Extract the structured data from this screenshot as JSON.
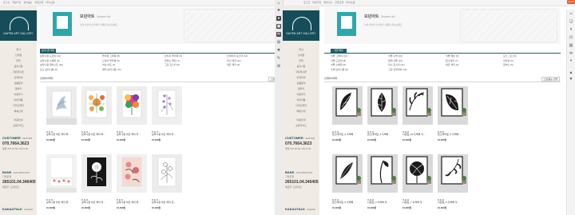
{
  "top": {
    "links": [
      "로그인",
      "회원가입",
      "장바구니",
      "주문조회",
      "마이쇼핑"
    ],
    "badge": "QUICK VIEW"
  },
  "shop": {
    "logo_text": "DAPEN ART GALLERY",
    "menu": [
      "회사",
      "인사말",
      "연혁",
      "공지사항",
      "자유게시판",
      "인테리어",
      "상품문의",
      "갤러리",
      "이용후기",
      "미술작품",
      "디자인액자",
      "배송안내",
      "서비스",
      "이벤트"
    ],
    "menu_sep_items": [
      "이용안내",
      "쇼핑가이드"
    ],
    "customer_label": "CUSTOMER",
    "customer_sub": "CENTER",
    "phone": "070.7664.3623",
    "hours": "평일 AM 10:00~PM 6:00",
    "bank_label": "BANK",
    "bank_sub": "INFORMATION",
    "bank_name": "기업은행",
    "account": "265101.04.346405",
    "holder": "예금주: 모던아트",
    "kakao_label": "KAKAOTALK",
    "kakao_sub": "FRIEND"
  },
  "left_page": {
    "banner_title": "모던아트",
    "banner_en": "Modern Art",
    "banner_desc": "현대 미술의 감각적인 작품을 만나보세요",
    "tab": "보타니컬 액자",
    "categories": [
      [
        "보타니컬 드로잉 (12)",
        "플라워 그래픽 (8)",
        "빈티지 플라워 (6)",
        "인테리어 포스터 (14)"
      ],
      [
        "보타니컬 수채화 (9)",
        "드라이 플라워 (5)",
        "캔버스 액자 (7)",
        "미니 액자 (11)"
      ],
      [
        "보타니컬 일러스트 (10)",
        "허브 아트 (4)",
        "그린 포스터 (6)",
        "세트 액자 (3)"
      ],
      [
        "모노 보타니컬 (8)",
        "컬러 보타니컬 (12)",
        "",
        ""
      ]
    ],
    "list_title": "인테리어액자",
    "sort": "신상품순 정렬",
    "products_row1": [
      {
        "name": "보타니컬 아트 액자 화...",
        "price": "15,000원"
      },
      {
        "name": "보타니컬 아트 액자 화...",
        "price": "15,000원"
      },
      {
        "name": "보타니컬 아트 액자 주...",
        "price": "15,000원"
      },
      {
        "name": "보타니컬 아트 액자 라...",
        "price": "15,000원"
      }
    ],
    "products_row2": [
      {
        "name": "보타니컬 아트 액자 꽃...",
        "price": "15,000원"
      },
      {
        "name": "보타니컬 아트 액자 작...",
        "price": "15,000원"
      },
      {
        "name": "보타니컬 아트 액자 꽃...",
        "price": "15,000원"
      },
      {
        "name": "보타니컬 아트 액자 흰...",
        "price": "15,000원"
      }
    ]
  },
  "right_page": {
    "banner_title": "모던아트",
    "banner_en": "Modern Art",
    "banner_desc": "현대 미술의 감각적인 작품을 만나보세요",
    "tab": "식물 액자",
    "categories": [
      [
        "식물 그래픽 (14)",
        "식물 흑백 (10)",
        "식물 패턴 (6)",
        "모노 그린 (9)"
      ],
      [
        "식물 드로잉 (8)",
        "열대 식물 (12)",
        "몬스테라 (7)",
        "야자잎 (5)"
      ],
      [
        "식물 수채화 (6)",
        "미니 포스터 (11)",
        "세트 액자 (4)",
        "캔버스 (5)"
      ],
      [
        "흑백 보타니컬 (9)",
        "그린 인테리어 (13)",
        "",
        ""
      ]
    ],
    "list_title": "인테리어액자",
    "sort": "신상품순 정렬",
    "products_row1": [
      {
        "name": "몬스테라잎_6 흑백벽...",
        "price": "15,000원"
      },
      {
        "name": "몬스테라잎_3 흑백벽...",
        "price": "15,000원"
      },
      {
        "name": "나뭇잎_10 흑백벽 식...",
        "price": "15,000원"
      },
      {
        "name": "몬스테라잎_5 흑백벽...",
        "price": "15,000원"
      }
    ],
    "products_row2": [
      {
        "name": "몬스테라잎_5 흑백벽...",
        "price": "15,000원"
      },
      {
        "name": "나뭇잎_6 흑백벽 식...",
        "price": "15,000원"
      },
      {
        "name": "나뭇잎_7 흑백벽 식...",
        "price": "15,000원"
      },
      {
        "name": "나뭇잎_5 흑백벽 식...",
        "price": "15,000원"
      }
    ]
  },
  "icons": {
    "rail": [
      "home-icon",
      "bookmark-icon",
      "user-icon",
      "chat-icon",
      "cart-icon",
      "edit-icon",
      "star-icon"
    ],
    "colors": {
      "teal": "#164d5a",
      "accent": "#e3572a",
      "banner": "#2aa9ad"
    }
  }
}
